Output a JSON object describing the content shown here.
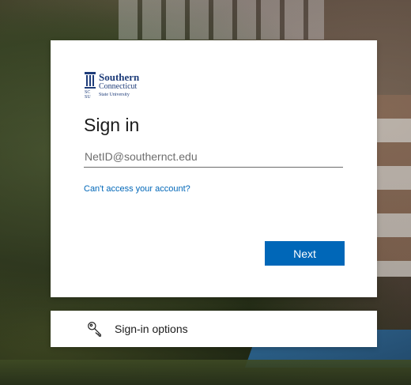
{
  "logo": {
    "line1": "Southern",
    "line2": "Connecticut",
    "line3": "State University",
    "color": "#1f3d7a"
  },
  "signin": {
    "title": "Sign in",
    "email_placeholder": "NetID@southernct.edu",
    "email_value": "",
    "cant_access_link": "Can't access your account?",
    "next_label": "Next"
  },
  "options": {
    "label": "Sign-in options",
    "icon": "key-icon"
  },
  "colors": {
    "accent": "#0067b8",
    "link": "#0067b8"
  }
}
